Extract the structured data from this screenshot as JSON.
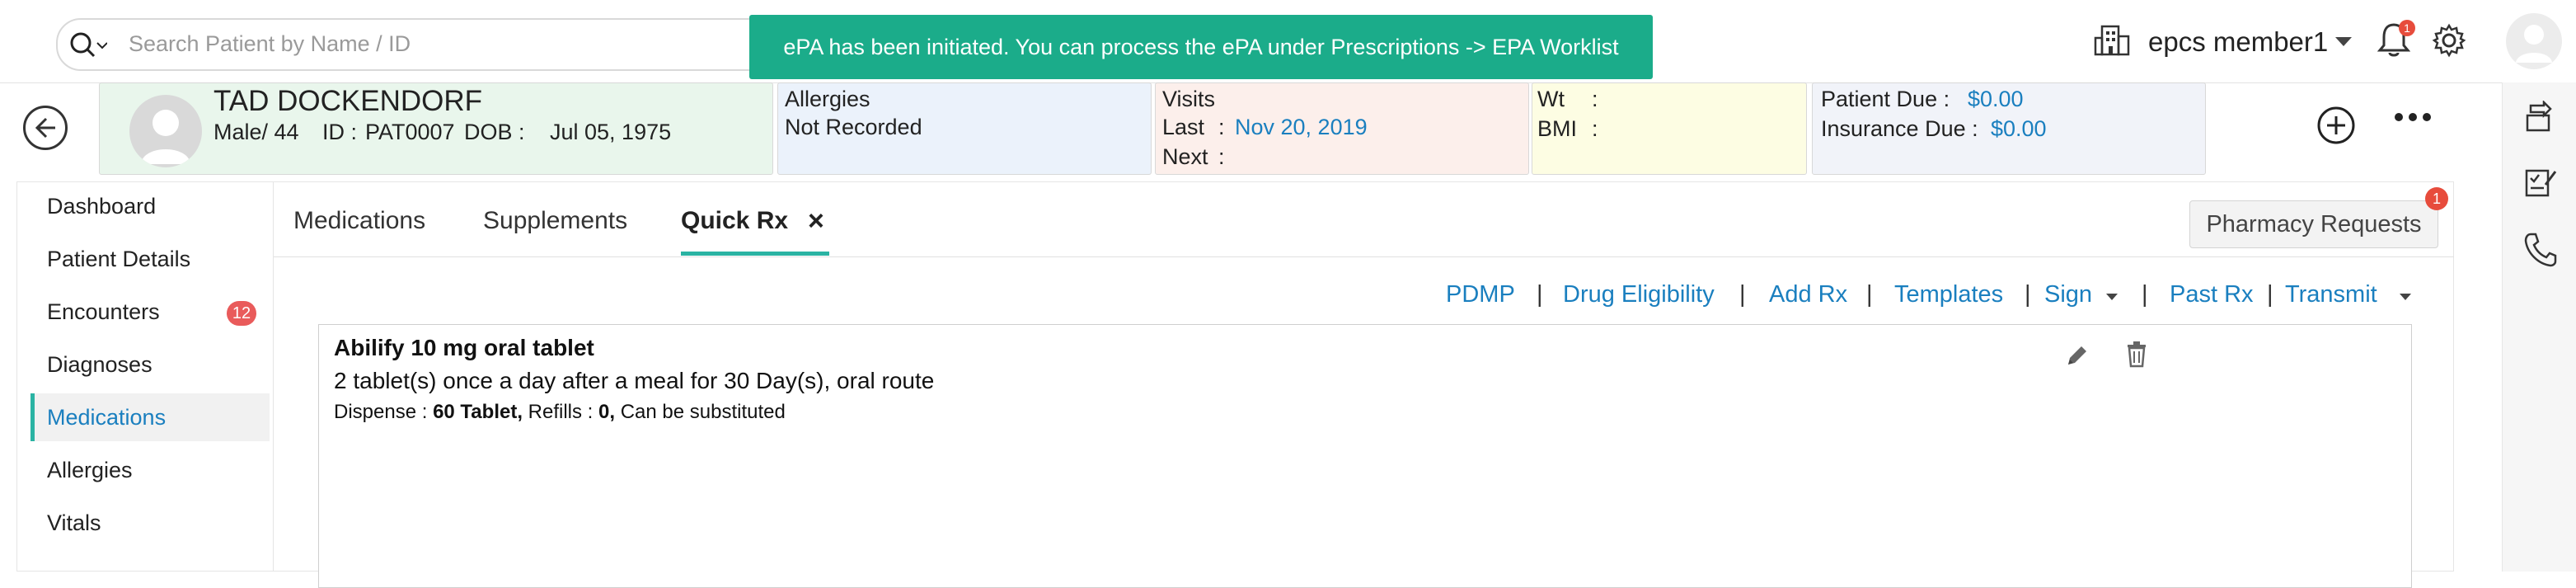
{
  "search": {
    "placeholder": "Search Patient by Name / ID"
  },
  "toast": {
    "message": "ePA has been initiated. You can process the ePA under Prescriptions -> EPA Worklist"
  },
  "user": {
    "name": "epcs member1",
    "notification_count": "1"
  },
  "patient": {
    "name": "TAD DOCKENDORF",
    "gender_age": "Male/ 44",
    "id_label": "ID :",
    "id": "PAT0007",
    "dob_label": "DOB :",
    "dob": "Jul 05, 1975"
  },
  "allergy_panel": {
    "title": "Allergies",
    "value": "Not Recorded"
  },
  "visits_panel": {
    "title": "Visits",
    "last_label": "Last",
    "last_value": "Nov 20, 2019",
    "next_label": "Next",
    "colon": ":"
  },
  "vitals_panel": {
    "wt_label": "Wt",
    "bmi_label": "BMI",
    "colon": ":"
  },
  "billing_panel": {
    "patient_due_label": "Patient Due :",
    "patient_due": "$0.00",
    "insurance_due_label": "Insurance Due :",
    "insurance_due": "$0.00"
  },
  "sidebar": {
    "items": [
      {
        "label": "Dashboard"
      },
      {
        "label": "Patient Details"
      },
      {
        "label": "Encounters",
        "badge": "12"
      },
      {
        "label": "Diagnoses"
      },
      {
        "label": "Medications",
        "active": true
      },
      {
        "label": "Allergies"
      },
      {
        "label": "Vitals"
      }
    ]
  },
  "tabs": [
    {
      "label": "Medications"
    },
    {
      "label": "Supplements"
    },
    {
      "label": "Quick Rx",
      "active": true
    }
  ],
  "tab_close": "×",
  "pharmacy_requests": {
    "label": "Pharmacy Requests",
    "badge": "1"
  },
  "actions": {
    "pdmp": "PDMP",
    "drug_eligibility": "Drug Eligibility",
    "add_rx": "Add Rx",
    "templates": "Templates",
    "sign": "Sign",
    "past_rx": "Past Rx",
    "transmit": "Transmit",
    "separator": "|"
  },
  "rx": {
    "name": "Abilify 10 mg oral tablet",
    "sig": "2 tablet(s) once a day after a meal for 30 Day(s), oral route",
    "dispense_label": "Dispense :",
    "dispense_value": "60 Tablet,",
    "refills_label": "Refills :",
    "refills_value": "0,",
    "substitution": "Can be substituted"
  },
  "colors": {
    "accent": "#1bac8a",
    "link": "#1a7fbf",
    "badge": "#e74c3c",
    "tab_underline": "#2ab3a3"
  }
}
